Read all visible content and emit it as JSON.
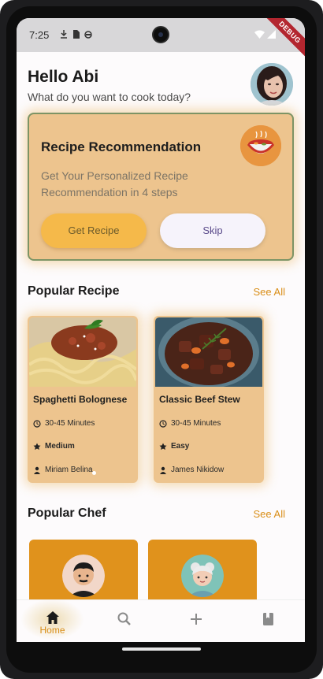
{
  "status_bar": {
    "time": "7:25",
    "debug_label": "DEBUG"
  },
  "header": {
    "greeting": "Hello Abi",
    "subtitle": "What do you want to cook today?"
  },
  "recommendation": {
    "title": "Recipe Recommendation",
    "subtitle": "Get Your Personalized Recipe Recommendation in 4 steps",
    "primary_button": "Get Recipe",
    "secondary_button": "Skip"
  },
  "popular_recipe": {
    "title": "Popular Recipe",
    "see_all": "See All",
    "items": [
      {
        "name": "Spaghetti Bolognese",
        "time": "30-45 Minutes",
        "difficulty": "Medium",
        "author": "Miriam Belina"
      },
      {
        "name": "Classic Beef Stew",
        "time": "30-45 Minutes",
        "difficulty": "Easy",
        "author": "James Nikidow"
      }
    ]
  },
  "popular_chef": {
    "title": "Popular Chef",
    "see_all": "See All"
  },
  "bottom_nav": {
    "items": [
      {
        "label": "Home",
        "icon": "home-icon",
        "active": true
      },
      {
        "label": "",
        "icon": "search-icon",
        "active": false
      },
      {
        "label": "",
        "icon": "add-icon",
        "active": false
      },
      {
        "label": "",
        "icon": "book-icon",
        "active": false
      }
    ]
  },
  "colors": {
    "accent": "#d98e17",
    "card": "#edc48e",
    "chef_card": "#e0921c",
    "button_primary": "#f5b94a"
  }
}
